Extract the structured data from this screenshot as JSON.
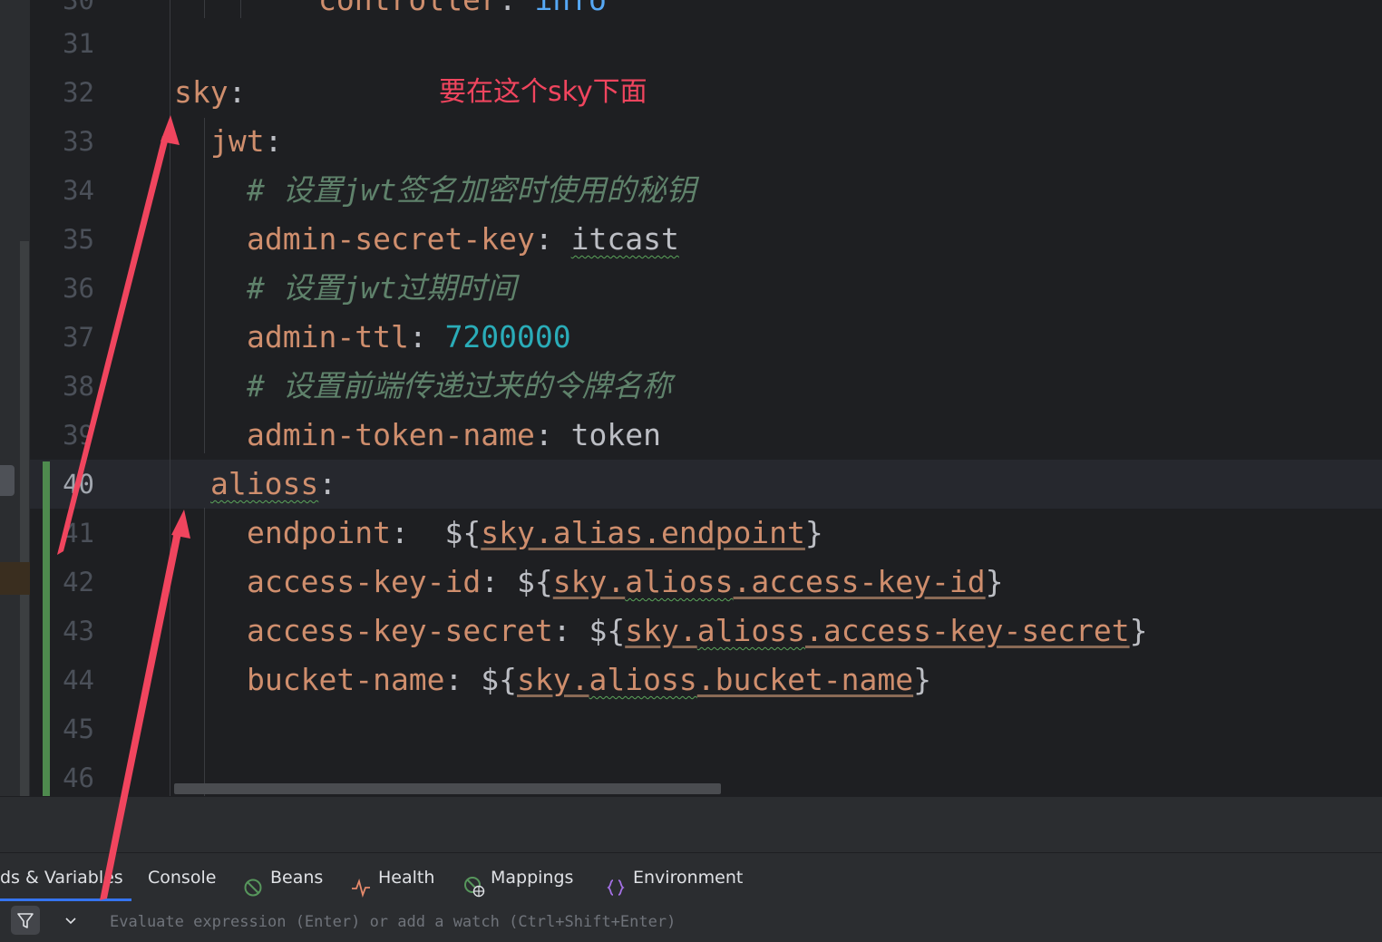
{
  "editor": {
    "partial_top_line": {
      "key": "controller",
      "value": "info"
    },
    "lines": [
      {
        "number": "31",
        "tokens": []
      },
      {
        "number": "32",
        "tokens": [
          {
            "cls": "k",
            "text": "sky"
          },
          {
            "cls": "p",
            "text": ":"
          }
        ]
      },
      {
        "number": "33",
        "tokens": [
          {
            "cls": "k",
            "text": "jwt"
          },
          {
            "cls": "p",
            "text": ":"
          }
        ]
      },
      {
        "number": "34",
        "tokens": [
          {
            "cls": "cm",
            "text": "# 设置jwt签名加密时使用的秘钥"
          }
        ]
      },
      {
        "number": "35",
        "tokens": [
          {
            "cls": "k",
            "text": "admin-secret-key"
          },
          {
            "cls": "p",
            "text": ": "
          },
          {
            "cls": "v wavy",
            "text": "itcast"
          }
        ]
      },
      {
        "number": "36",
        "tokens": [
          {
            "cls": "cm",
            "text": "# 设置jwt过期时间"
          }
        ]
      },
      {
        "number": "37",
        "tokens": [
          {
            "cls": "k",
            "text": "admin-ttl"
          },
          {
            "cls": "p",
            "text": ": "
          },
          {
            "cls": "num",
            "text": "7200000"
          }
        ]
      },
      {
        "number": "38",
        "tokens": [
          {
            "cls": "cm",
            "text": "# 设置前端传递过来的令牌名称"
          }
        ]
      },
      {
        "number": "39",
        "tokens": [
          {
            "cls": "k",
            "text": "admin-token-name"
          },
          {
            "cls": "p",
            "text": ": "
          },
          {
            "cls": "v",
            "text": "token"
          }
        ]
      },
      {
        "number": "40",
        "tokens": [
          {
            "cls": "k wavy",
            "text": "alioss"
          },
          {
            "cls": "p",
            "text": ":"
          }
        ]
      },
      {
        "number": "41",
        "tokens": [
          {
            "cls": "k",
            "text": "endpoint"
          },
          {
            "cls": "p",
            "text": ":  ${"
          },
          {
            "cls": "ref",
            "text": "sky.alias.endpoint"
          },
          {
            "cls": "p",
            "text": "}"
          }
        ]
      },
      {
        "number": "42",
        "tokens": [
          {
            "cls": "k",
            "text": "access-key-id"
          },
          {
            "cls": "p",
            "text": ": ${"
          },
          {
            "cls": "ref",
            "text": "sky."
          },
          {
            "cls": "ref wavy",
            "text": "alioss"
          },
          {
            "cls": "ref",
            "text": ".access-key-id"
          },
          {
            "cls": "p",
            "text": "}"
          }
        ]
      },
      {
        "number": "43",
        "tokens": [
          {
            "cls": "k",
            "text": "access-key-secret"
          },
          {
            "cls": "p",
            "text": ": ${"
          },
          {
            "cls": "ref",
            "text": "sky."
          },
          {
            "cls": "ref wavy",
            "text": "alioss"
          },
          {
            "cls": "ref",
            "text": ".access-key-secret"
          },
          {
            "cls": "p",
            "text": "}"
          }
        ]
      },
      {
        "number": "44",
        "tokens": [
          {
            "cls": "k",
            "text": "bucket-name"
          },
          {
            "cls": "p",
            "text": ": ${"
          },
          {
            "cls": "ref",
            "text": "sky."
          },
          {
            "cls": "ref wavy",
            "text": "alioss"
          },
          {
            "cls": "ref",
            "text": ".bucket-name"
          },
          {
            "cls": "p",
            "text": "}"
          }
        ]
      },
      {
        "number": "45",
        "tokens": []
      },
      {
        "number": "46",
        "tokens": []
      }
    ],
    "current_line": "40",
    "annotation": "要在这个sky下面"
  },
  "debug_panel": {
    "tabs": [
      {
        "label": "ds & Variables",
        "icon": "none",
        "active": true
      },
      {
        "label": "Console",
        "icon": "none",
        "active": false
      },
      {
        "label": "Beans",
        "icon": "beans-icon",
        "active": false
      },
      {
        "label": "Health",
        "icon": "health-icon",
        "active": false
      },
      {
        "label": "Mappings",
        "icon": "mappings-icon",
        "active": false
      },
      {
        "label": "Environment",
        "icon": "environment-icon",
        "active": false
      }
    ],
    "evaluate": {
      "placeholder": "Evaluate expression (Enter) or add a watch (Ctrl+Shift+Enter)",
      "value": ""
    }
  },
  "colors": {
    "background": "#1e1f22",
    "key": "#cf8e6d",
    "number": "#2aacb8",
    "comment": "#5f826b",
    "annotation": "#f0455e",
    "change_marker": "#4e8a4e",
    "active_tab": "#3574f0"
  }
}
